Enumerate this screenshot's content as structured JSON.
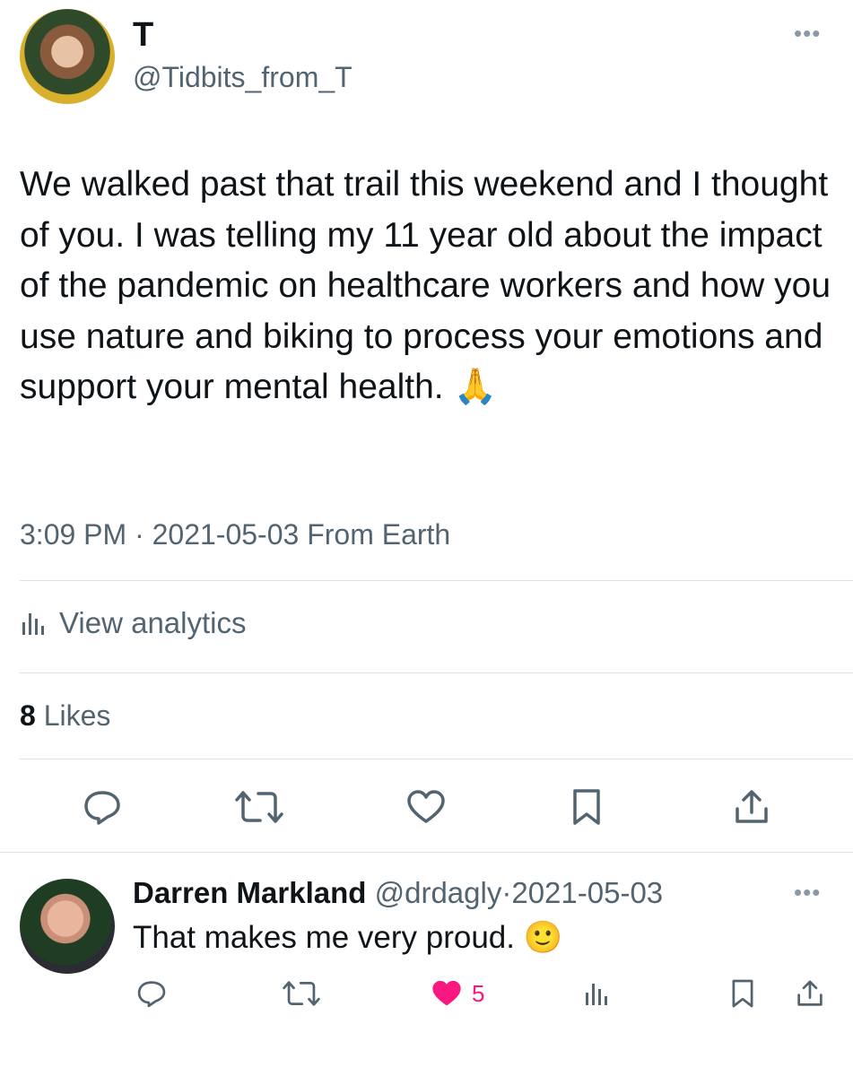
{
  "tweet": {
    "display_name": "T",
    "handle": "@Tidbits_from_T",
    "text": "We walked past that trail this weekend and I thought of you. I was telling my 11 year old about the impact of the pandemic on healthcare workers and how you use nature and biking to process your emotions and support your mental health. 🙏",
    "time": "3:09 PM",
    "date": "2021-05-03",
    "source": "From Earth",
    "analytics_label": "View analytics",
    "likes_count": "8",
    "likes_label": "Likes"
  },
  "reply": {
    "display_name": "Darren Markland",
    "handle": "@drdagly",
    "date": "2021-05-03",
    "text": "That makes me very proud. 🙂",
    "like_count": "5"
  },
  "colors": {
    "text": "#0f1419",
    "secondary": "#536471",
    "divider": "#dfe3e6",
    "liked": "#f91880"
  },
  "icons": [
    "more-icon",
    "reply-icon",
    "retweet-icon",
    "like-icon",
    "bookmark-icon",
    "share-icon",
    "analytics-icon"
  ]
}
